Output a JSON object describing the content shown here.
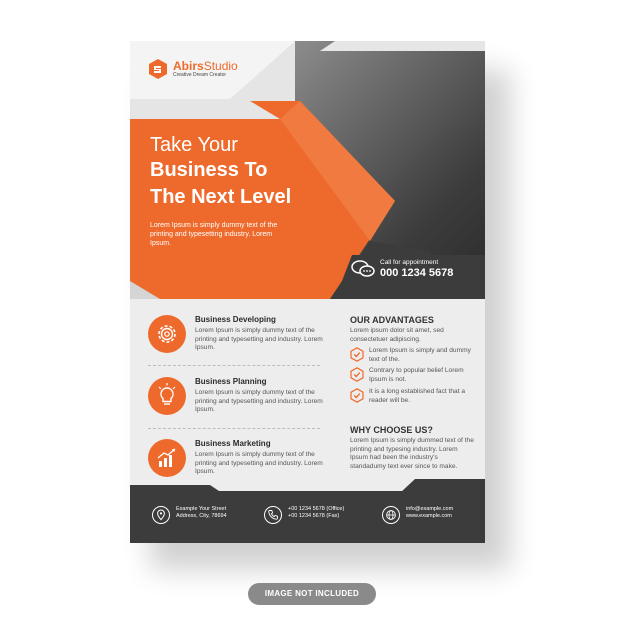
{
  "logo": {
    "brand_bold": "Abirs",
    "brand_light": "Studio",
    "tagline": "Creative Dream Creator"
  },
  "hero": {
    "line1": "Take Your",
    "line2": "Business To",
    "line3": "The Next Level",
    "text": "Lorem Ipsum is simply dummy text of the printing and typesetting industry. Lorem Ipsum."
  },
  "call": {
    "label": "Call for appointment",
    "number": "000 1234 5678"
  },
  "services": [
    {
      "title": "Business Developing",
      "text": "Lorem Ipsum is simply dummy text of the printing and typesetting and industry. Lorem Ipsum.",
      "icon": "gear-icon"
    },
    {
      "title": "Business Planning",
      "text": "Lorem Ipsum is simply dummy text of the printing and typesetting and industry. Lorem Ipsum.",
      "icon": "lightbulb-icon"
    },
    {
      "title": "Business Marketing",
      "text": "Lorem Ipsum is simply dummy text of the printing and typesetting and industry. Lorem Ipsum.",
      "icon": "growth-chart-icon"
    }
  ],
  "advantages": {
    "title": "OUR ADVANTAGES",
    "intro": "Lorem ipsum dolor sit amet, sed consectetuer adipiscing.",
    "items": [
      "Lorem Ipsum is simply and dummy text of the.",
      "Contrary to popular belief Lorem Ipsum is not.",
      "It is a long established fact that a reader will be."
    ]
  },
  "why": {
    "title": "WHY CHOOSE US?",
    "text": "Lorem Ipsum is simply dummed text of the printing and typesing industry. Lorem Ipsum had been the industry's standadumy text ever since  to make."
  },
  "footer": {
    "address": [
      "Example Your Street",
      "Address, City, 78694"
    ],
    "phones": [
      "+00 1234 5678 (Office)",
      "+00 1234 5678 (Fax)"
    ],
    "web": [
      "info@example.com",
      "www.example.com"
    ]
  },
  "stamp": "IMAGE NOT INCLUDED",
  "colors": {
    "accent": "#ee6a2c",
    "dark": "#3c3c3c",
    "light": "#ededed"
  }
}
